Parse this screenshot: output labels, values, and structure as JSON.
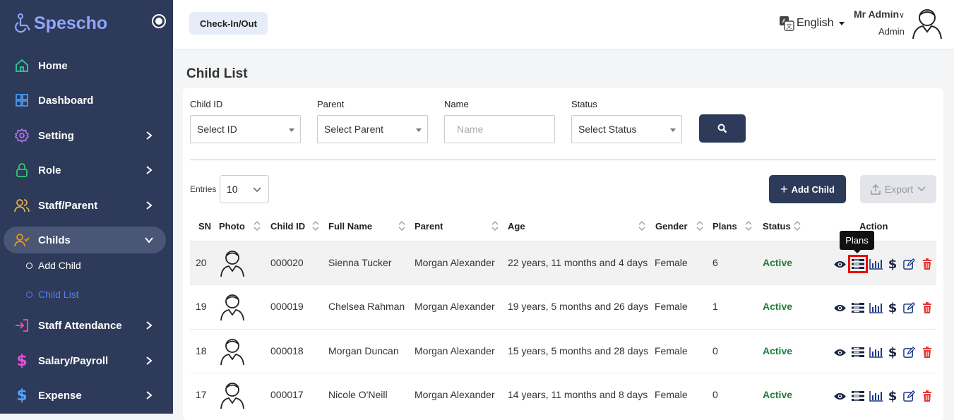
{
  "brand": {
    "name": "Spescho",
    "accent": "#8fa6ff"
  },
  "sidebar": {
    "bg": "#2e3a59",
    "items": [
      {
        "label": "Home",
        "icon": "home-icon"
      },
      {
        "label": "Dashboard",
        "icon": "grid-icon"
      },
      {
        "label": "Setting",
        "icon": "gear-icon"
      },
      {
        "label": "Role",
        "icon": "lock-icon"
      },
      {
        "label": "Staff/Parent",
        "icon": "users-icon"
      },
      {
        "label": "Childs",
        "icon": "user-check-icon"
      },
      {
        "label": "Staff Attendance",
        "icon": "login-icon"
      },
      {
        "label": "Salary/Payroll",
        "icon": "dollar-icon"
      },
      {
        "label": "Expense",
        "icon": "dollar-icon"
      }
    ],
    "sub_items": [
      {
        "label": "Add Child"
      },
      {
        "label": "Child List"
      }
    ]
  },
  "topbar": {
    "checkin_label": "Check-In/Out",
    "language": "English",
    "user_name": "Mr Admin",
    "user_role": "Admin"
  },
  "page": {
    "title": "Child List"
  },
  "filters": {
    "child_id": {
      "label": "Child ID",
      "value": "Select ID"
    },
    "parent": {
      "label": "Parent",
      "value": "Select Parent"
    },
    "name": {
      "label": "Name",
      "placeholder": "Name"
    },
    "status": {
      "label": "Status",
      "value": "Select Status"
    }
  },
  "toolbar": {
    "entries_label": "Entries",
    "entries_value": "10",
    "add_label": "Add Child",
    "export_label": "Export"
  },
  "table": {
    "headers": [
      "SN",
      "Photo",
      "Child ID",
      "Full Name",
      "Parent",
      "Age",
      "Gender",
      "Plans",
      "Status",
      "Action"
    ],
    "rows": [
      {
        "sn": "20",
        "child_id": "000020",
        "full_name": "Sienna Tucker",
        "parent": "Morgan Alexander",
        "age": "22 years, 11 months and 4 days",
        "gender": "Female",
        "plans": "6",
        "status": "Active"
      },
      {
        "sn": "19",
        "child_id": "000019",
        "full_name": "Chelsea Rahman",
        "parent": "Morgan Alexander",
        "age": "19 years, 5 months and 26 days",
        "gender": "Female",
        "plans": "1",
        "status": "Active"
      },
      {
        "sn": "18",
        "child_id": "000018",
        "full_name": "Morgan Duncan",
        "parent": "Morgan Alexander",
        "age": "15 years, 5 months and 28 days",
        "gender": "Female",
        "plans": "0",
        "status": "Active"
      },
      {
        "sn": "17",
        "child_id": "000017",
        "full_name": "Nicole O'Neill",
        "parent": "Morgan Alexander",
        "age": "14 years, 11 months and 8 days",
        "gender": "Female",
        "plans": "0",
        "status": "Active"
      }
    ]
  },
  "tooltip": {
    "text": "Plans"
  },
  "colors": {
    "status_active": "#1e7d3a",
    "action_blue": "#1f3a8a",
    "delete_red": "#e53935"
  }
}
